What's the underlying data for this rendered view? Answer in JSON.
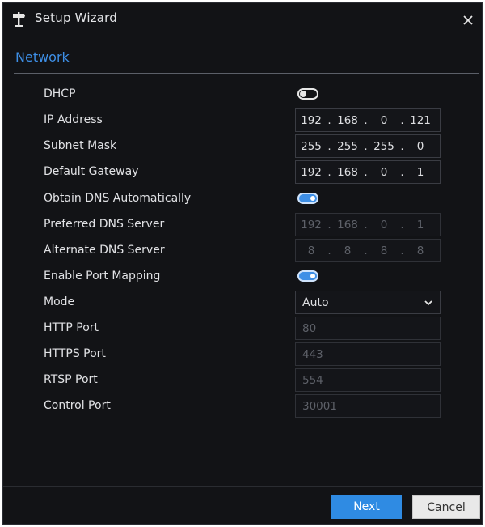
{
  "window": {
    "title": "Setup Wizard",
    "icons": {
      "logo": "signpost-icon",
      "close": "close-icon"
    }
  },
  "tabs": [
    {
      "label": "Network",
      "active": true
    }
  ],
  "form": {
    "dhcp": {
      "label": "DHCP",
      "enabled": false
    },
    "ip_address": {
      "label": "IP Address",
      "octets": [
        "192",
        "168",
        "0",
        "121"
      ]
    },
    "subnet_mask": {
      "label": "Subnet Mask",
      "octets": [
        "255",
        "255",
        "255",
        "0"
      ]
    },
    "default_gateway": {
      "label": "Default Gateway",
      "octets": [
        "192",
        "168",
        "0",
        "1"
      ]
    },
    "obtain_dns": {
      "label": "Obtain DNS Automatically",
      "enabled": true
    },
    "preferred_dns": {
      "label": "Preferred DNS Server",
      "octets": [
        "192",
        "168",
        "0",
        "1"
      ],
      "disabled": true
    },
    "alternate_dns": {
      "label": "Alternate DNS Server",
      "octets": [
        "8",
        "8",
        "8",
        "8"
      ],
      "disabled": true
    },
    "port_mapping": {
      "label": "Enable Port Mapping",
      "enabled": true
    },
    "mode": {
      "label": "Mode",
      "value": "Auto"
    },
    "http_port": {
      "label": "HTTP Port",
      "value": "80"
    },
    "https_port": {
      "label": "HTTPS Port",
      "value": "443"
    },
    "rtsp_port": {
      "label": "RTSP Port",
      "value": "554"
    },
    "control_port": {
      "label": "Control Port",
      "value": "30001"
    }
  },
  "buttons": {
    "next": "Next",
    "cancel": "Cancel"
  },
  "colors": {
    "accent": "#3e8fe6",
    "background": "#121316",
    "primary_button": "#2f8be3"
  }
}
